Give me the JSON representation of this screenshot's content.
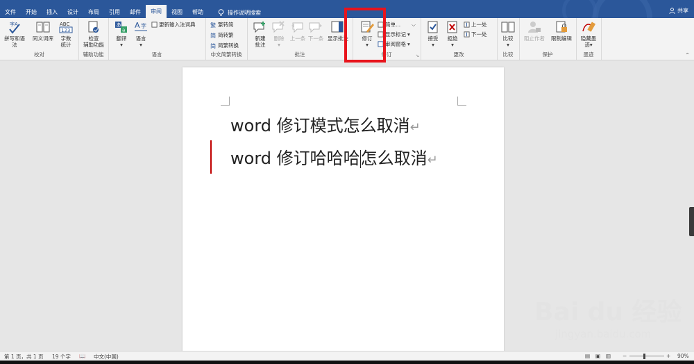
{
  "titlebar": {
    "tabs": [
      "文件",
      "开始",
      "插入",
      "设计",
      "布局",
      "引用",
      "邮件",
      "审阅",
      "视图",
      "帮助"
    ],
    "active_tab": "审阅",
    "tell_me": "操作说明搜索",
    "share": "共享"
  },
  "ribbon": {
    "groups": {
      "proofing": {
        "label": "校对",
        "spelling": "拼写和语法",
        "thesaurus": "同义词库",
        "word_count_line1": "字数",
        "word_count_line2": "统计",
        "abc": "ABC",
        "abc_num": "123"
      },
      "accessibility": {
        "label": "辅助功能",
        "check_line1": "检查",
        "check_line2": "辅助功能"
      },
      "language": {
        "label": "语言",
        "translate": "翻译",
        "language": "语言",
        "update_ime": "更新输入法词典"
      },
      "chinese_conversion": {
        "label": "中文简繁转换",
        "to_simplified": "繁转简",
        "to_traditional": "简转繁",
        "convert": "简繁转换"
      },
      "comments": {
        "label": "批注",
        "new_line1": "新建",
        "new_line2": "批注",
        "delete": "删除",
        "previous": "上一条",
        "next": "下一条",
        "show": "显示批注"
      },
      "tracking": {
        "label": "修订",
        "track_changes": "修订",
        "simple_markup": "简单...",
        "show_markup": "显示标记",
        "reviewing_pane": "审阅窗格"
      },
      "changes": {
        "label": "更改",
        "accept": "接受",
        "reject": "拒绝",
        "previous": "上一处",
        "next": "下一处"
      },
      "compare": {
        "label": "比较",
        "compare": "比较"
      },
      "protect": {
        "label": "保护",
        "block_authors": "阻止作者",
        "restrict_editing": "限制编辑"
      },
      "ink": {
        "label": "墨迹",
        "hide_ink_line1": "隐藏墨",
        "hide_ink_line2": "迹"
      }
    }
  },
  "document": {
    "line1": "word 修订模式怎么取消",
    "line2_before_caret": "word 修订哈哈哈",
    "line2_after_caret": "怎么取消",
    "paragraph_mark": "↵"
  },
  "statusbar": {
    "page": "第 1 页，共 1 页",
    "words": "19 个字",
    "language": "中文(中国)",
    "zoom": "90%"
  },
  "watermark": {
    "line1": "Bai du 经验",
    "line2": "jingyan.baidu.com"
  },
  "colors": {
    "titlebar": "#2b579a",
    "highlight_box": "#e8141c",
    "change_bar": "#c00000"
  }
}
